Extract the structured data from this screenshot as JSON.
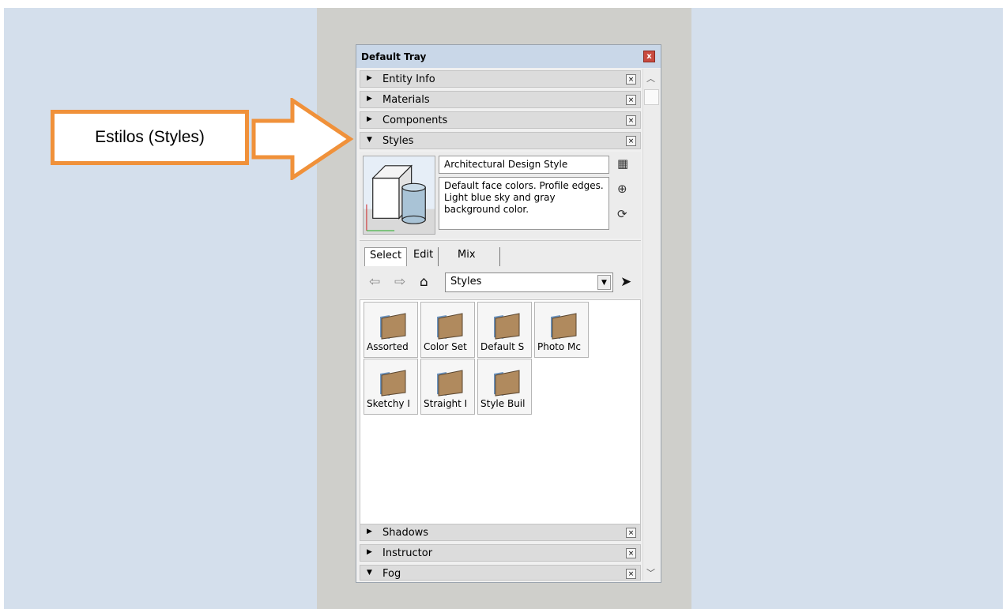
{
  "callout": {
    "label": "Estilos (Styles)"
  },
  "tray": {
    "title": "Default Tray",
    "close_glyph": "x",
    "panels_top": [
      {
        "label": "Entity Info",
        "state": "collapsed"
      },
      {
        "label": "Materials",
        "state": "collapsed"
      },
      {
        "label": "Components",
        "state": "collapsed"
      },
      {
        "label": "Styles",
        "state": "expanded"
      }
    ],
    "panels_bottom": [
      {
        "label": "Shadows",
        "state": "collapsed"
      },
      {
        "label": "Instructor",
        "state": "collapsed"
      },
      {
        "label": "Fog",
        "state": "expanded"
      }
    ],
    "panel_close_glyph": "×",
    "glyphs": {
      "collapsed": "▶",
      "expanded": "▼"
    }
  },
  "styles": {
    "name": "Architectural Design Style",
    "description": "Default face colors. Profile edges. Light blue sky and gray background color.",
    "tabs": [
      "Select",
      "Edit",
      "Mix"
    ],
    "library": "Styles",
    "folders": [
      "Assorted",
      "Color Set",
      "Default S",
      "Photo Mc",
      "Sketchy I",
      "Straight I",
      "Style Buil"
    ]
  },
  "colors": {
    "callout_border": "#f0913a",
    "tray_title_bg": "#c9d7e8",
    "background": "#d4dfec"
  }
}
